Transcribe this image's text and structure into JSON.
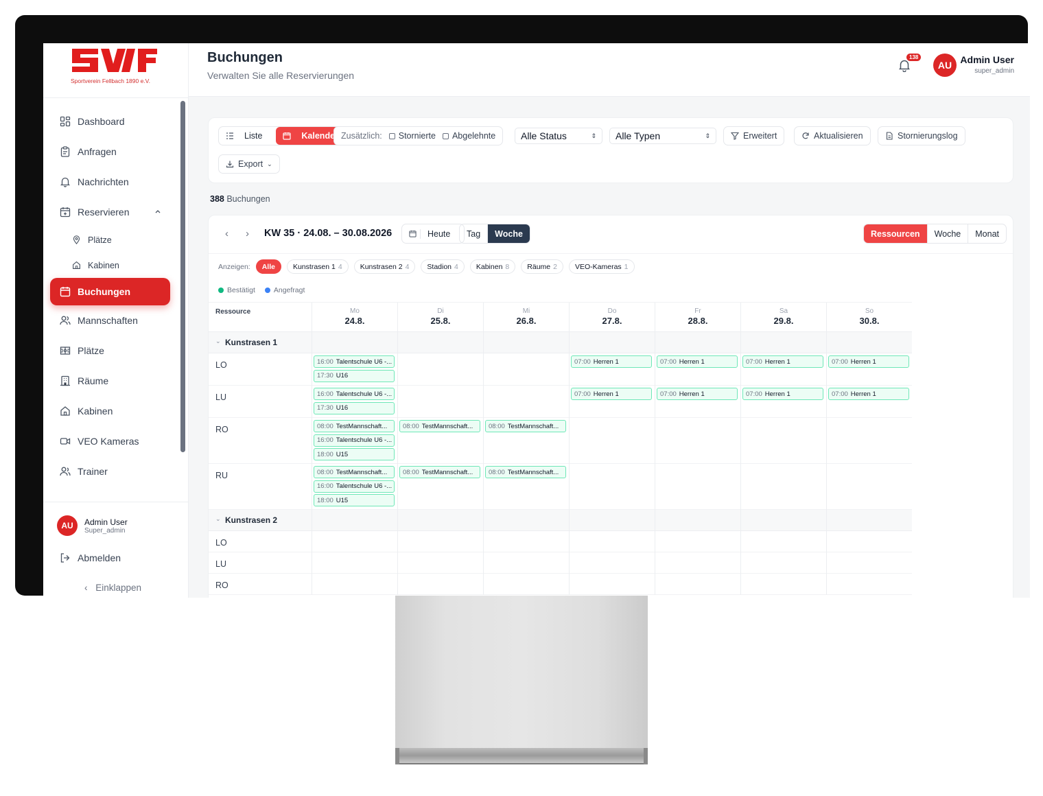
{
  "brand": {
    "logo_text": "SVF",
    "subtitle": "Sportverein Fellbach 1890 e.V.",
    "color": "#dc2626"
  },
  "sidebar": {
    "items": [
      {
        "label": "Dashboard",
        "icon": "grid-icon"
      },
      {
        "label": "Anfragen",
        "icon": "clipboard-icon"
      },
      {
        "label": "Nachrichten",
        "icon": "bell-icon"
      },
      {
        "label": "Reservieren",
        "icon": "calendar-plus-icon"
      },
      {
        "label": "Plätze",
        "icon": "map-pin-icon"
      },
      {
        "label": "Kabinen",
        "icon": "home-icon"
      },
      {
        "label": "Buchungen",
        "icon": "calendar-icon"
      },
      {
        "label": "Mannschaften",
        "icon": "users-icon"
      },
      {
        "label": "Plätze",
        "icon": "field-icon"
      },
      {
        "label": "Räume",
        "icon": "building-icon"
      },
      {
        "label": "Kabinen",
        "icon": "home-icon"
      },
      {
        "label": "VEO Kameras",
        "icon": "video-icon"
      },
      {
        "label": "Trainer",
        "icon": "trainer-icon"
      }
    ],
    "user_name": "Admin User",
    "user_role": "Super_admin",
    "avatar": "AU",
    "logout": "Abmelden",
    "collapse": "Einklappen"
  },
  "header": {
    "title": "Buchungen",
    "subtitle": "Verwalten Sie alle Reservierungen",
    "notification_count": "138",
    "avatar": "AU",
    "user_name": "Admin User",
    "user_role": "super_admin"
  },
  "toolbar": {
    "list": "Liste",
    "calendar": "Kalender",
    "additional": "Zusätzlich:",
    "cancelled": "Stornierte",
    "rejected": "Abgelehnte",
    "status": "Alle Status",
    "types": "Alle Typen",
    "advanced": "Erweitert",
    "refresh": "Aktualisieren",
    "cancel_log": "Stornierungslog",
    "export": "Export"
  },
  "count": {
    "number": "388",
    "label": "Buchungen"
  },
  "calendar": {
    "week_label": "KW 35 · 24.08. – 30.08.2026",
    "today": "Heute",
    "day": "Tag",
    "week": "Woche",
    "resources": "Ressourcen",
    "week2": "Woche",
    "month": "Monat",
    "show_label": "Anzeigen:",
    "filters": [
      {
        "label": "Alle",
        "count": ""
      },
      {
        "label": "Kunstrasen 1",
        "count": "4"
      },
      {
        "label": "Kunstrasen 2",
        "count": "4"
      },
      {
        "label": "Stadion",
        "count": "4"
      },
      {
        "label": "Kabinen",
        "count": "8"
      },
      {
        "label": "Räume",
        "count": "2"
      },
      {
        "label": "VEO-Kameras",
        "count": "1"
      }
    ],
    "legend": {
      "confirmed": "Bestätigt",
      "requested": "Angefragt",
      "confirmed_color": "#10b981",
      "requested_color": "#3b82f6"
    },
    "resource_header": "Ressource",
    "days": [
      {
        "name": "Mo",
        "date": "24.8."
      },
      {
        "name": "Di",
        "date": "25.8."
      },
      {
        "name": "Mi",
        "date": "26.8."
      },
      {
        "name": "Do",
        "date": "27.8."
      },
      {
        "name": "Fr",
        "date": "28.8."
      },
      {
        "name": "Sa",
        "date": "29.8."
      },
      {
        "name": "So",
        "date": "30.8."
      }
    ],
    "groups": [
      {
        "name": "Kunstrasen 1",
        "rows": [
          {
            "label": "LO",
            "events": [
              [
                {
                  "time": "16:00",
                  "title": "Talentschule U6 -..."
                },
                {
                  "time": "17:30",
                  "title": "U16"
                }
              ],
              [],
              [],
              [
                {
                  "time": "07:00",
                  "title": "Herren 1"
                }
              ],
              [
                {
                  "time": "07:00",
                  "title": "Herren 1"
                }
              ],
              [
                {
                  "time": "07:00",
                  "title": "Herren 1"
                }
              ],
              [
                {
                  "time": "07:00",
                  "title": "Herren 1"
                }
              ]
            ]
          },
          {
            "label": "LU",
            "events": [
              [
                {
                  "time": "16:00",
                  "title": "Talentschule U6 -..."
                },
                {
                  "time": "17:30",
                  "title": "U16"
                }
              ],
              [],
              [],
              [
                {
                  "time": "07:00",
                  "title": "Herren 1"
                }
              ],
              [
                {
                  "time": "07:00",
                  "title": "Herren 1"
                }
              ],
              [
                {
                  "time": "07:00",
                  "title": "Herren 1"
                }
              ],
              [
                {
                  "time": "07:00",
                  "title": "Herren 1"
                }
              ]
            ]
          },
          {
            "label": "RO",
            "events": [
              [
                {
                  "time": "08:00",
                  "title": "TestMannschaft..."
                },
                {
                  "time": "16:00",
                  "title": "Talentschule U6 -..."
                },
                {
                  "time": "18:00",
                  "title": "U15"
                }
              ],
              [
                {
                  "time": "08:00",
                  "title": "TestMannschaft..."
                }
              ],
              [
                {
                  "time": "08:00",
                  "title": "TestMannschaft..."
                }
              ],
              [],
              [],
              [],
              []
            ]
          },
          {
            "label": "RU",
            "events": [
              [
                {
                  "time": "08:00",
                  "title": "TestMannschaft..."
                },
                {
                  "time": "16:00",
                  "title": "Talentschule U6 -..."
                },
                {
                  "time": "18:00",
                  "title": "U15"
                }
              ],
              [
                {
                  "time": "08:00",
                  "title": "TestMannschaft..."
                }
              ],
              [
                {
                  "time": "08:00",
                  "title": "TestMannschaft..."
                }
              ],
              [],
              [],
              [],
              []
            ]
          }
        ]
      },
      {
        "name": "Kunstrasen 2",
        "rows": [
          {
            "label": "LO",
            "events": [
              [],
              [],
              [],
              [],
              [],
              [],
              []
            ]
          },
          {
            "label": "LU",
            "events": [
              [],
              [],
              [],
              [],
              [],
              [],
              []
            ]
          },
          {
            "label": "RO",
            "events": [
              [],
              [],
              [],
              [],
              [],
              [],
              []
            ]
          }
        ]
      }
    ]
  }
}
